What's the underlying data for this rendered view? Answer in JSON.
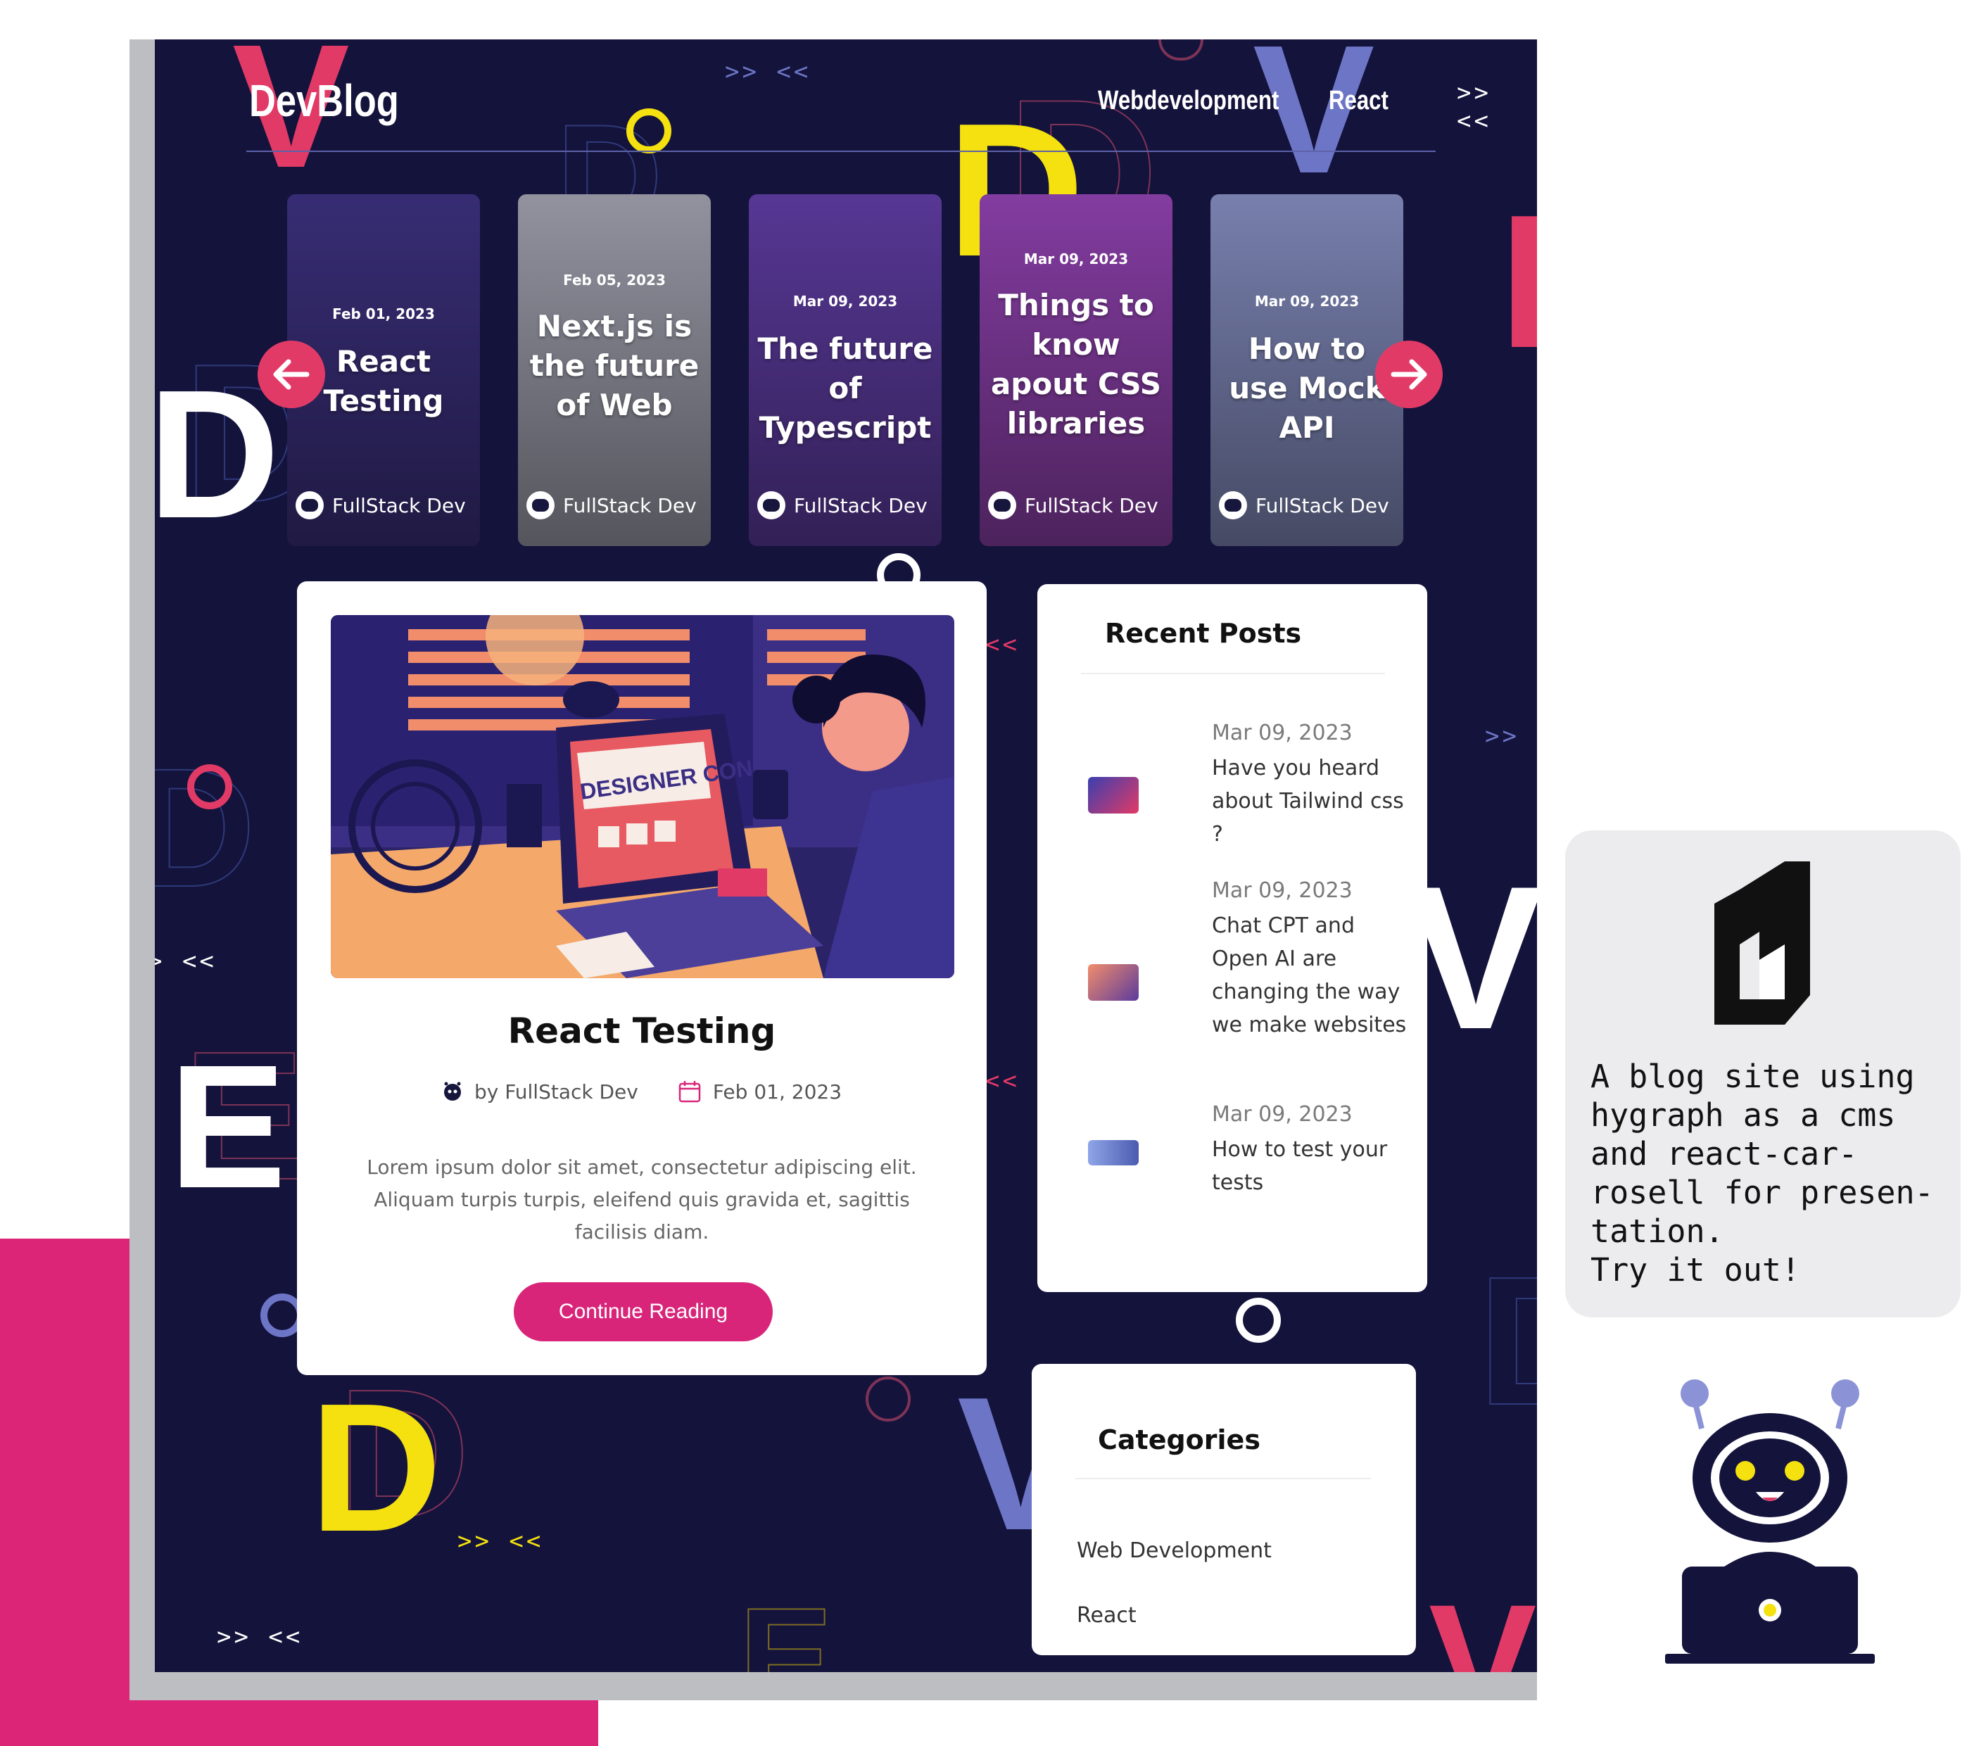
{
  "site": {
    "logo": "DevBlog",
    "nav": [
      "Webdevelopment",
      "React"
    ]
  },
  "carousel": {
    "cards": [
      {
        "date": "Feb 01, 2023",
        "title": "React Testing",
        "author": "FullStack Dev",
        "color": "#3a2f7a"
      },
      {
        "date": "Feb 05, 2023",
        "title": "Next.js is the future of Web",
        "author": "FullStack Dev",
        "color": "#9a9aa8"
      },
      {
        "date": "Mar 09, 2023",
        "title": "The future of Typescript",
        "author": "FullStack Dev",
        "color": "#5b3a9c"
      },
      {
        "date": "Mar 09, 2023",
        "title": "Things to know apout CSS libraries",
        "author": "FullStack Dev",
        "color": "#8a3fa8"
      },
      {
        "date": "Mar 09, 2023",
        "title": "How to use Mock API",
        "author": "FullStack Dev",
        "color": "#7e86b6"
      }
    ],
    "accent": "#e23a66"
  },
  "post": {
    "title": "React Testing",
    "author": "by FullStack Dev",
    "date": "Feb 01, 2023",
    "excerpt": "Lorem ipsum dolor sit amet, consectetur adipiscing elit. Aliquam turpis turpis, eleifend quis gravida et, sagittis facilisis diam.",
    "button": "Continue Reading",
    "image_sign": "DESIGNER CONFIDENTIAL",
    "accent": "#d8257a"
  },
  "recent": {
    "title": "Recent Posts",
    "items": [
      {
        "date": "Mar 09, 2023",
        "title": "Have you heard about Tailwind css ?"
      },
      {
        "date": "Mar 09, 2023",
        "title": "Chat CPT and Open AI are changing the way we make websites"
      },
      {
        "date": "Mar 09, 2023",
        "title": "How to test your tests"
      }
    ]
  },
  "categories": {
    "title": "Categories",
    "items": [
      "Web Development",
      "React"
    ]
  },
  "presentation": {
    "description": "A blog site using\nhygraph as a cms\nand react-car-\nrosell for presen-\ntation.\nTry it out!",
    "background_color": "#14133c",
    "accent_pink": "#dd2577"
  }
}
